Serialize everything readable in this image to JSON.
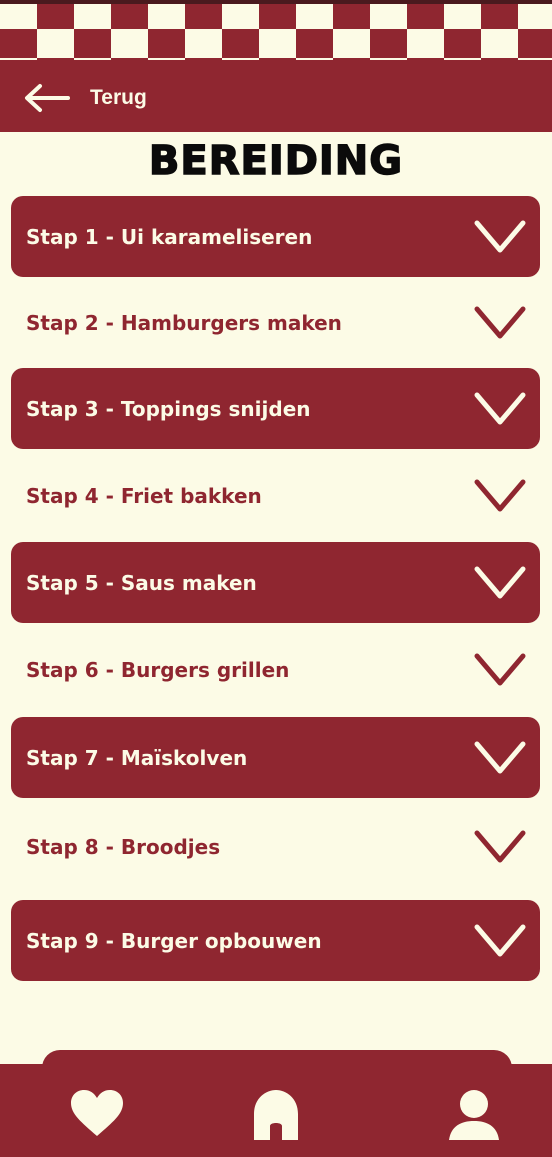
{
  "header": {
    "back_label": "Terug",
    "back_icon": "arrow-left-icon"
  },
  "page": {
    "title": "BEREIDING"
  },
  "steps": [
    {
      "label": "Stap 1 - Ui karameliseren",
      "style": "filled",
      "icon": "chevron-down-icon"
    },
    {
      "label": "Stap 2 - Hamburgers maken",
      "style": "plain",
      "icon": "chevron-down-icon"
    },
    {
      "label": "Stap 3 - Toppings snijden",
      "style": "filled",
      "icon": "chevron-down-icon"
    },
    {
      "label": "Stap 4 - Friet bakken",
      "style": "plain",
      "icon": "chevron-down-icon"
    },
    {
      "label": "Stap 5 - Saus maken",
      "style": "filled",
      "icon": "chevron-down-icon"
    },
    {
      "label": "Stap 6 - Burgers grillen",
      "style": "plain",
      "icon": "chevron-down-icon"
    },
    {
      "label": "Stap 7 - Maïskolven",
      "style": "filled",
      "icon": "chevron-down-icon"
    },
    {
      "label": "Stap 8 - Broodjes",
      "style": "plain",
      "icon": "chevron-down-icon"
    },
    {
      "label": "Stap 9 - Burger opbouwen",
      "style": "filled",
      "icon": "chevron-down-icon"
    }
  ],
  "bottom_nav": {
    "items": [
      {
        "icon": "heart-icon"
      },
      {
        "icon": "home-icon"
      },
      {
        "icon": "user-icon"
      }
    ]
  },
  "colors": {
    "brand": "#8f2630",
    "background": "#fcfbe6",
    "title": "#0b0b0b"
  }
}
